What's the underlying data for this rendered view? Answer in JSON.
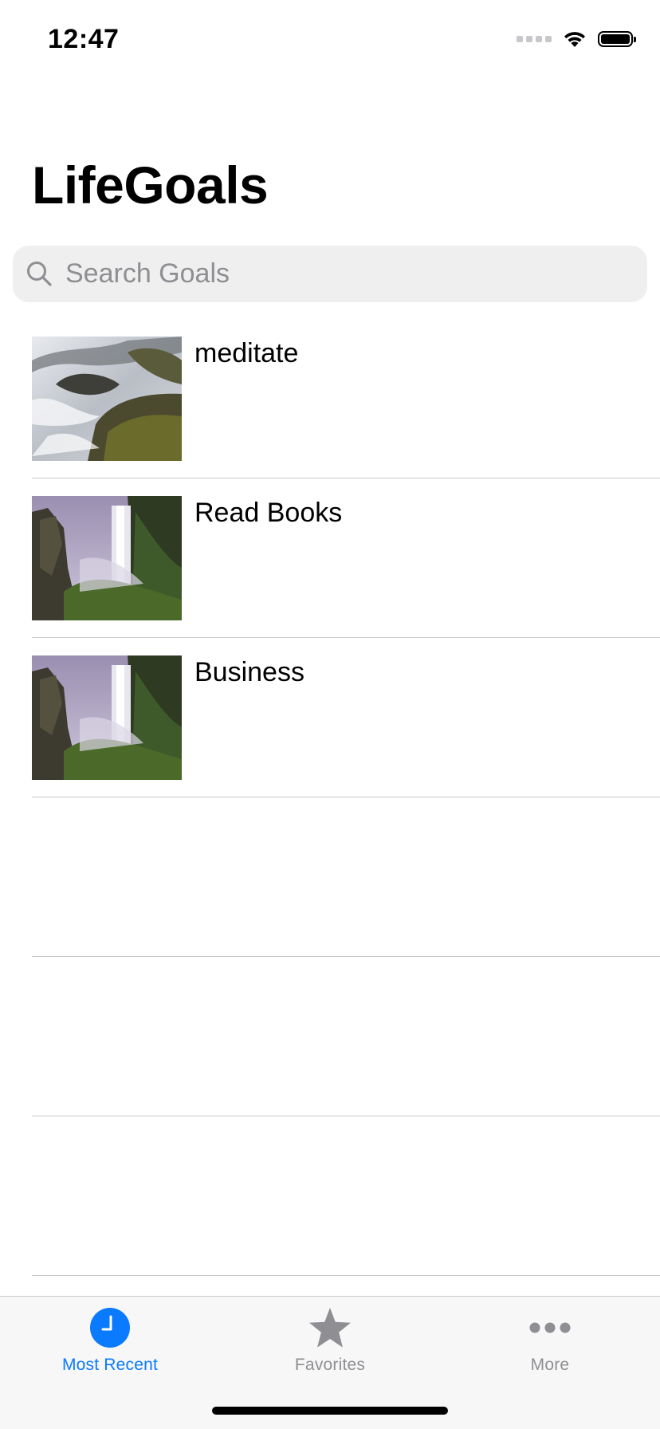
{
  "status_bar": {
    "time": "12:47"
  },
  "header": {
    "title": "LifeGoals"
  },
  "search": {
    "placeholder": "Search Goals",
    "value": ""
  },
  "goals": [
    {
      "title": "meditate",
      "image": "stream-over-rocks-photo"
    },
    {
      "title": "Read Books",
      "image": "waterfall-photo"
    },
    {
      "title": "Business",
      "image": "waterfall-photo"
    }
  ],
  "tab_bar": {
    "active_color": "#0a7aff",
    "inactive_color": "#8e8e93",
    "tabs": [
      {
        "label": "Most Recent",
        "icon": "clock-icon",
        "active": true
      },
      {
        "label": "Favorites",
        "icon": "star-icon",
        "active": false
      },
      {
        "label": "More",
        "icon": "more-icon",
        "active": false
      }
    ]
  }
}
